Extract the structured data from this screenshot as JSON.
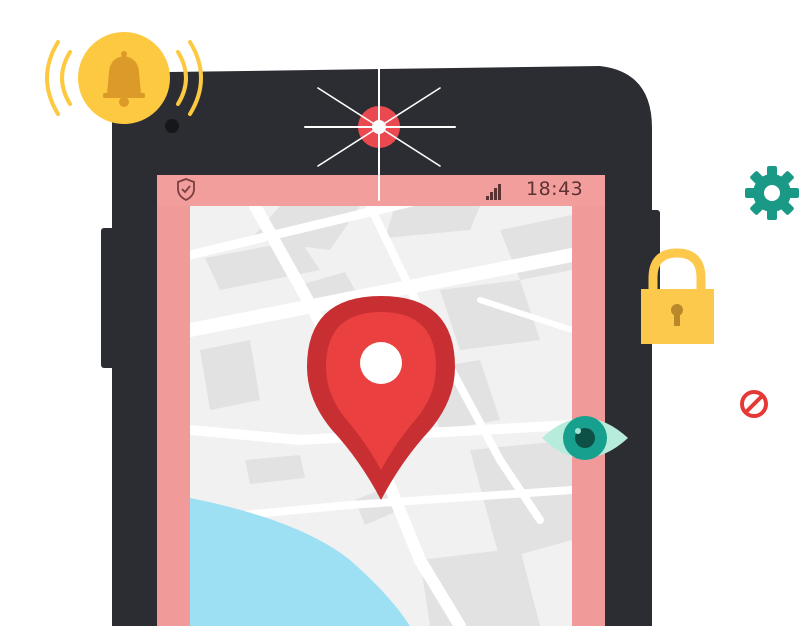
{
  "status_bar": {
    "time": "18:43",
    "signal_icon": "signal-bars-icon",
    "shield_icon": "shield-check-icon"
  },
  "icons": {
    "notification": "bell-ringing-icon",
    "camera_flash": "camera-flash-icon",
    "settings": "gear-icon",
    "lock": "padlock-icon",
    "block": "no-entry-icon",
    "eye": "eye-icon",
    "location": "map-pin-icon"
  },
  "colors": {
    "phone_body": "#2b2d32",
    "screen_alert_border": "#f09a99",
    "bell_yellow": "#fcc940",
    "map_pin_red": "#ea4040",
    "gear_teal": "#1a9a86",
    "lock_yellow": "#fdc94c",
    "block_red": "#e53935",
    "eye_teal": "#17a08d",
    "water_blue": "#9de0f4"
  }
}
